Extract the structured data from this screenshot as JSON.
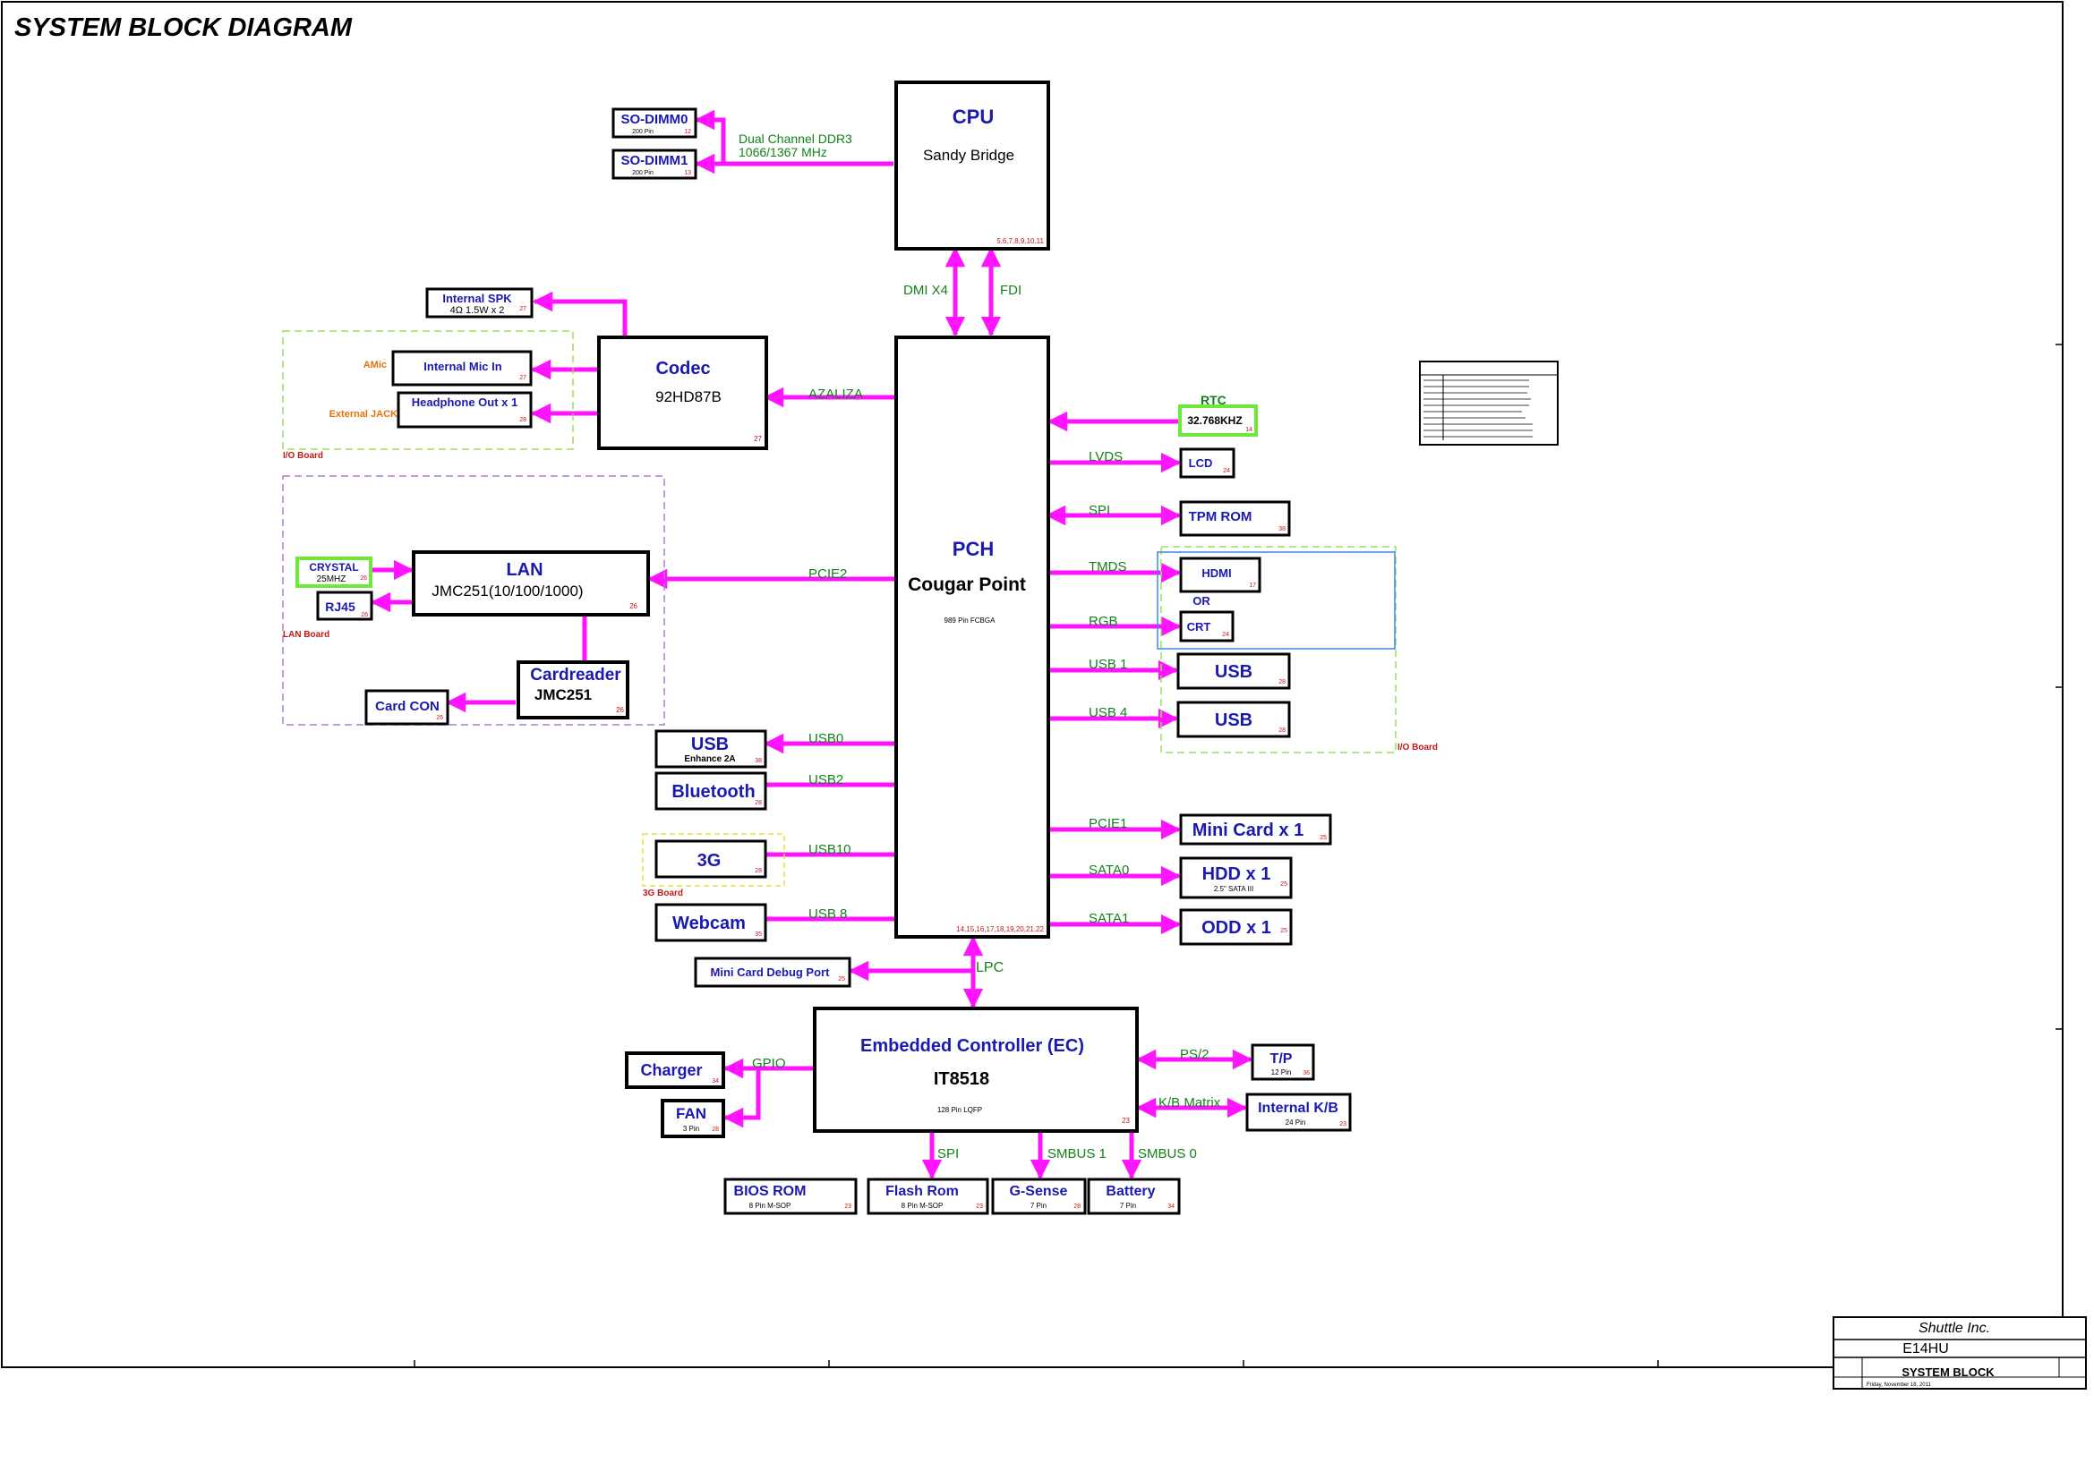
{
  "title": "SYSTEM BLOCK DIAGRAM",
  "blocks": {
    "cpu": {
      "name": "CPU",
      "model": "Sandy Bridge",
      "pages": "5,6,7,8,9,10,11"
    },
    "pch": {
      "name": "PCH",
      "model": "Cougar Point",
      "package": "989 Pin FCBGA",
      "pages": "14,15,16,17,18,19,20,21,22"
    },
    "codec": {
      "name": "Codec",
      "model": "92HD87B",
      "page": "27"
    },
    "lan": {
      "name": "LAN",
      "model": "JMC251(10/100/1000)",
      "page": "26"
    },
    "cardreader": {
      "name": "Cardreader",
      "model": "JMC251",
      "page": "26"
    },
    "ec": {
      "name": "Embedded Controller (EC)",
      "model": "IT8518",
      "package": "128 Pin LQFP",
      "page": "23"
    }
  },
  "peripherals": {
    "sodimm0": {
      "label": "SO-DIMM0",
      "sub": "200 Pin",
      "page": "12"
    },
    "sodimm1": {
      "label": "SO-DIMM1",
      "sub": "200 Pin",
      "page": "13"
    },
    "internal_spk": {
      "label": "Internal SPK",
      "sub": "4Ω 1.5W x 2",
      "page": "27"
    },
    "internal_mic": {
      "label": "Internal Mic In",
      "page": "27"
    },
    "headphone": {
      "label": "Headphone Out x 1",
      "page": "28"
    },
    "crystal": {
      "label": "CRYSTAL",
      "sub": "25MHZ",
      "page": "26"
    },
    "rj45": {
      "label": "RJ45",
      "page": "26"
    },
    "card_con": {
      "label": "Card CON",
      "page": "26"
    },
    "usb_left": {
      "label": "USB",
      "sub": "Enhance 2A",
      "page": "38"
    },
    "bluetooth": {
      "label": "Bluetooth",
      "page": "28"
    },
    "g3": {
      "label": "3G",
      "page": "28"
    },
    "webcam": {
      "label": "Webcam",
      "page": "35"
    },
    "mini_card_debug": {
      "label": "Mini Card Debug Port",
      "page": "25"
    },
    "rtc_crystal": {
      "label": "32.768KHZ",
      "page": "14"
    },
    "lcd": {
      "label": "LCD",
      "page": "24"
    },
    "tpm": {
      "label": "TPM ROM",
      "page": "38"
    },
    "hdmi": {
      "label": "HDMI",
      "page": "17"
    },
    "crt": {
      "label": "CRT",
      "page": "24"
    },
    "usb_r1": {
      "label": "USB",
      "page": "28"
    },
    "usb_r2": {
      "label": "USB",
      "page": "28"
    },
    "mini_card": {
      "label": "Mini Card x 1",
      "page": "25"
    },
    "hdd": {
      "label": "HDD x 1",
      "sub": "2.5\" SATA III",
      "page": "25"
    },
    "odd": {
      "label": "ODD x 1",
      "page": "25"
    },
    "charger": {
      "label": "Charger",
      "page": "34"
    },
    "fan": {
      "label": "FAN",
      "sub": "3 Pin",
      "page": "28"
    },
    "tp": {
      "label": "T/P",
      "sub": "12 Pin",
      "page": "36"
    },
    "internal_kb": {
      "label": "Internal K/B",
      "sub": "24 Pin",
      "page": "23"
    },
    "bios_rom": {
      "label": "BIOS ROM",
      "sub": "8 Pin M-SOP",
      "page": "23"
    },
    "flash_rom": {
      "label": "Flash Rom",
      "sub": "8 Pin M-SOP",
      "page": "23"
    },
    "gsense": {
      "label": "G-Sense",
      "sub": "7 Pin",
      "page": "28"
    },
    "battery": {
      "label": "Battery",
      "sub": "7 Pin",
      "page": "34"
    }
  },
  "buses": {
    "ddr": "Dual Channel DDR3",
    "ddr_speed": "1066/1367 MHz",
    "dmi": "DMI X4",
    "fdi": "FDI",
    "azalia": "AZALIZA",
    "pcie2": "PCIE2",
    "usb0": "USB0",
    "usb2": "USB2",
    "usb10": "USB10",
    "usb8": "USB 8",
    "rtc": "RTC",
    "lvds": "LVDS",
    "spi_pch": "SPI",
    "tmds": "TMDS",
    "or": "OR",
    "rgb": "RGB",
    "usb1": "USB 1",
    "usb4": "USB 4",
    "pcie1": "PCIE1",
    "sata0": "SATA0",
    "sata1": "SATA1",
    "lpc": "LPC",
    "gpio": "GPIO",
    "ps2": "PS/2",
    "kb_matrix": "K/B Matrix",
    "spi_ec": "SPI",
    "smbus1": "SMBUS 1",
    "smbus0": "SMBUS 0"
  },
  "board_labels": {
    "amic": "AMic",
    "external_jack": "External JACK",
    "io_board_left": "I/O Board",
    "lan_board": "LAN Board",
    "g3_board": "3G Board",
    "io_board_right": "I/O Board"
  },
  "title_block": {
    "company": "Shuttle Inc.",
    "project": "E14HU",
    "document": "SYSTEM BLOCK",
    "date": "Friday, November 18, 2011"
  }
}
